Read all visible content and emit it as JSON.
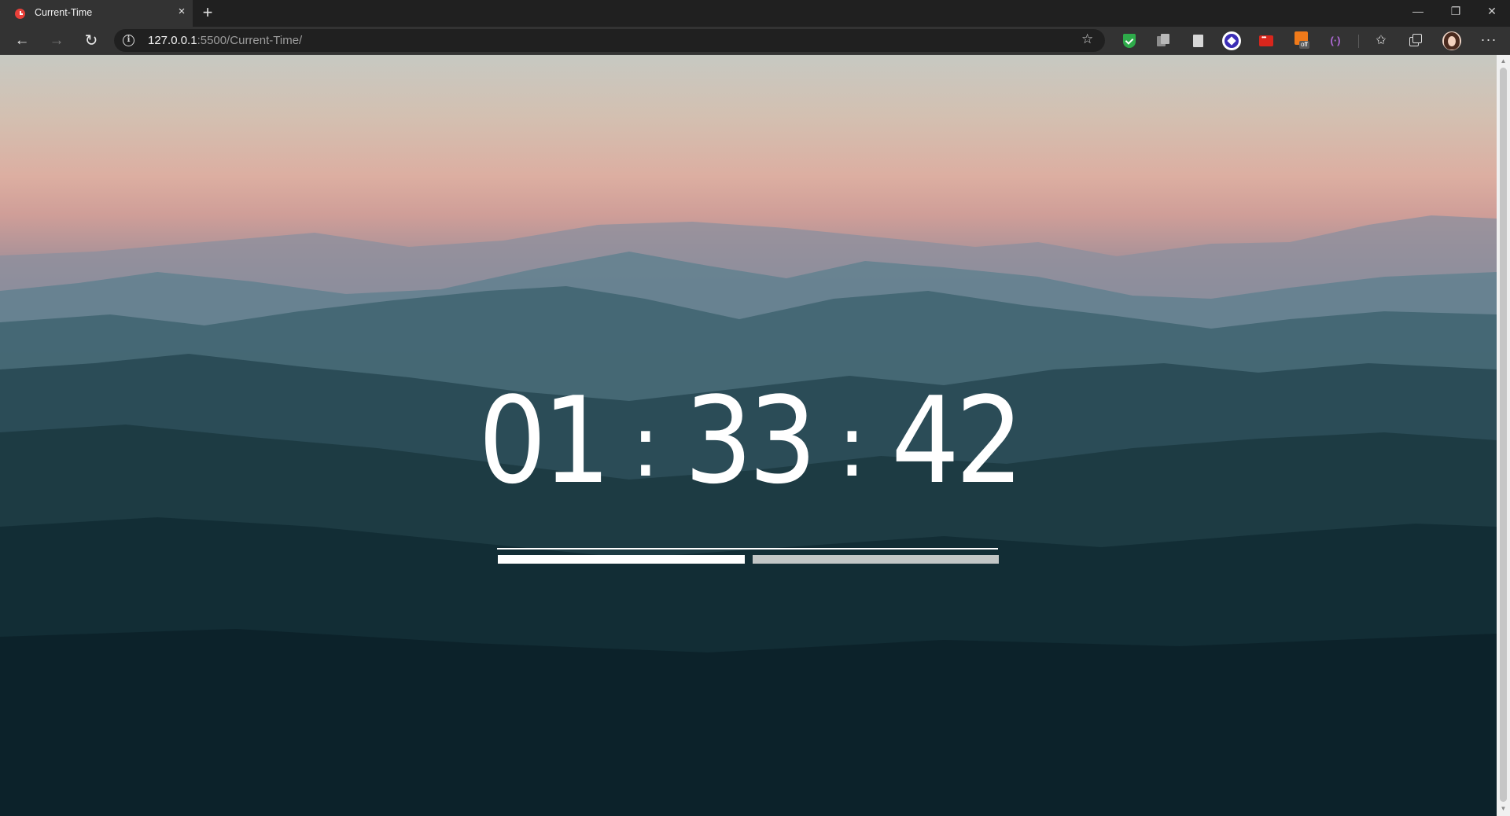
{
  "browser": {
    "tab_title": "Current-Time",
    "tab_close": "×",
    "new_tab": "+",
    "window_controls": {
      "minimize": "—",
      "maximize": "❐",
      "close": "✕"
    },
    "nav": {
      "back": "←",
      "forward": "→",
      "reload": "↻"
    },
    "url_host": "127.0.0.1",
    "url_rest": ":5500/Current-Time/",
    "extensions": [
      "shield-check-icon",
      "copy-icon",
      "document-icon",
      "circle-diamond-icon",
      "red-dots-icon",
      "off-badge-icon",
      "paren-icon",
      "favorites-icon",
      "collections-icon"
    ],
    "off_badge": "off",
    "paren_glyph": "(·)",
    "more": "···"
  },
  "clock": {
    "hours": "01",
    "minutes": "33",
    "seconds": "42",
    "separator": ":"
  },
  "colors": {
    "accent_bar": "#ffffff",
    "secondary_bar": "#c2c6c6",
    "chrome_bg": "#333333"
  }
}
